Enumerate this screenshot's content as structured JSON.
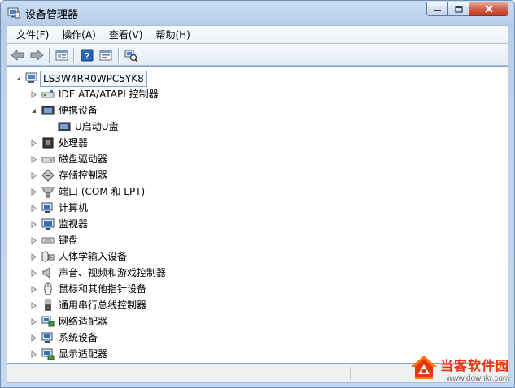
{
  "window": {
    "title": "设备管理器"
  },
  "menu": {
    "items": [
      "文件(F)",
      "操作(A)",
      "查看(V)",
      "帮助(H)"
    ]
  },
  "toolbar": {
    "buttons": [
      "back-arrow-icon",
      "forward-arrow-icon",
      "properties-icon",
      "help-icon",
      "update-driver-icon",
      "scan-hardware-icon"
    ]
  },
  "tree": {
    "root": "LS3W4RR0WPC5YK8",
    "nodes": [
      {
        "label": "IDE ATA/ATAPI 控制器",
        "icon": "ide-controller-icon",
        "expanded": false
      },
      {
        "label": "便携设备",
        "icon": "portable-device-icon",
        "expanded": true
      },
      {
        "label": "U启动U盘",
        "icon": "usb-drive-icon",
        "child": true
      },
      {
        "label": "处理器",
        "icon": "processor-icon",
        "expanded": false
      },
      {
        "label": "磁盘驱动器",
        "icon": "disk-drive-icon",
        "expanded": false
      },
      {
        "label": "存储控制器",
        "icon": "storage-controller-icon",
        "expanded": false
      },
      {
        "label": "端口 (COM 和 LPT)",
        "icon": "port-icon",
        "expanded": false
      },
      {
        "label": "计算机",
        "icon": "computer-icon",
        "expanded": false
      },
      {
        "label": "监视器",
        "icon": "monitor-icon",
        "expanded": false
      },
      {
        "label": "键盘",
        "icon": "keyboard-icon",
        "expanded": false
      },
      {
        "label": "人体学输入设备",
        "icon": "hid-icon",
        "expanded": false
      },
      {
        "label": "声音、视频和游戏控制器",
        "icon": "sound-icon",
        "expanded": false
      },
      {
        "label": "鼠标和其他指针设备",
        "icon": "mouse-icon",
        "expanded": false
      },
      {
        "label": "通用串行总线控制器",
        "icon": "usb-controller-icon",
        "expanded": false
      },
      {
        "label": "网络适配器",
        "icon": "network-adapter-icon",
        "expanded": false
      },
      {
        "label": "系统设备",
        "icon": "system-device-icon",
        "expanded": false
      },
      {
        "label": "显示适配器",
        "icon": "display-adapter-icon",
        "expanded": false
      }
    ]
  },
  "watermark": {
    "name": "当客软件园",
    "url": "www.downkr.com"
  },
  "colors": {
    "frame": "#bcd2ec",
    "accent_blue": "#2a64b4",
    "close_red": "#c23a21",
    "watermark_red": "#e8360d"
  }
}
